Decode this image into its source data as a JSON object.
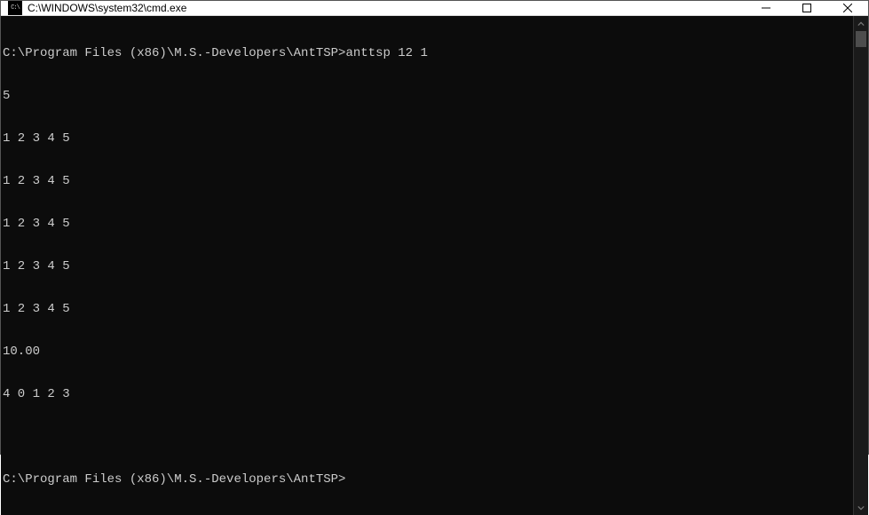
{
  "titlebar": {
    "icon_text": "C:\\",
    "title": "C:\\WINDOWS\\system32\\cmd.exe"
  },
  "terminal": {
    "lines": [
      "C:\\Program Files (x86)\\M.S.-Developers\\AntTSP>anttsp 12 1",
      "5",
      "1 2 3 4 5",
      "1 2 3 4 5",
      "1 2 3 4 5",
      "1 2 3 4 5",
      "1 2 3 4 5",
      "10.00",
      "4 0 1 2 3",
      "",
      "C:\\Program Files (x86)\\M.S.-Developers\\AntTSP>"
    ]
  }
}
